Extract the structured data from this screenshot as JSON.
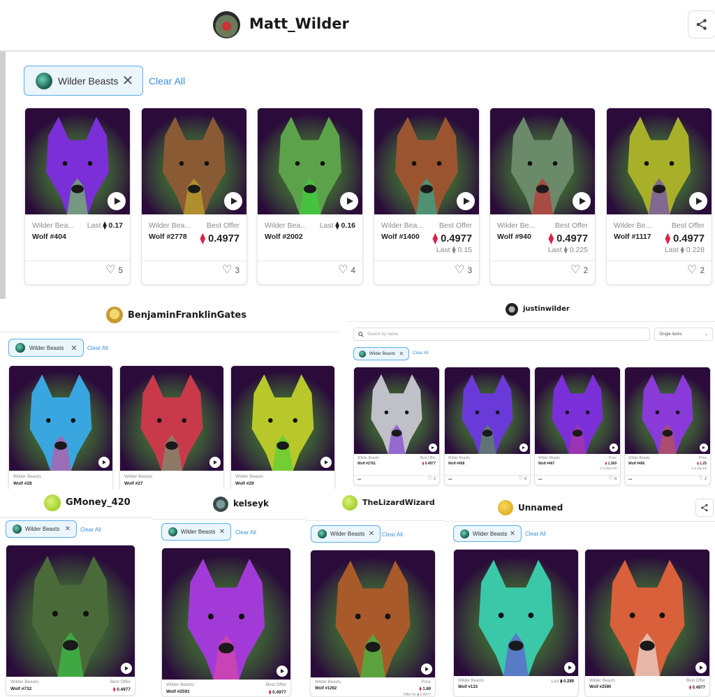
{
  "collection_label": "Wilder Beasts",
  "clear_all": "Clear All",
  "screens": {
    "matt": {
      "username": "Matt_Wilder",
      "cards": [
        {
          "collection": "Wilder Bea...",
          "name": "Wolf #404",
          "price_label": "Last",
          "price": "0.17",
          "likes": "5",
          "colors": [
            "#7a2fd8",
            "#6fe04a",
            "#2a0b3a"
          ]
        },
        {
          "collection": "Wilder Bea...",
          "name": "Wolf #2778",
          "price_label": "Best Offer",
          "price": "0.4977",
          "likes": "3",
          "colors": [
            "#8a5a34",
            "#c8b22a",
            "#2a1a0a"
          ]
        },
        {
          "collection": "Wilder Bea...",
          "name": "Wolf #2002",
          "price_label": "Last",
          "price": "0.16",
          "likes": "4",
          "colors": [
            "#5ca24a",
            "#39d63a",
            "#0d2a0b"
          ]
        },
        {
          "collection": "Wilder Bea...",
          "name": "Wolf #1400",
          "price_label": "Best Offer",
          "price": "0.4977",
          "sub_label": "Last",
          "sub_price": "0.15",
          "likes": "3",
          "colors": [
            "#9a5530",
            "#1fb8a0",
            "#2a1008"
          ]
        },
        {
          "collection": "Wilder Be...",
          "name": "Wolf #940",
          "price_label": "Best Offer",
          "price": "0.4977",
          "sub_label": "Last",
          "sub_price": "0.225",
          "likes": "2",
          "colors": [
            "#6a8a6a",
            "#d2232a",
            "#1a0a0a"
          ]
        },
        {
          "collection": "Wilder Be...",
          "name": "Wolf #1117",
          "price_label": "Best Offer",
          "price": "0.4977",
          "sub_label": "Last",
          "sub_price": "0.228",
          "likes": "2",
          "colors": [
            "#a8b02a",
            "#6a3ad8",
            "#1a1a06"
          ]
        }
      ]
    },
    "benjamin": {
      "username": "BenjaminFranklinGates",
      "cards": [
        {
          "collection": "Wilder Beasts",
          "name": "Wolf #28",
          "colors": [
            "#3aa6e0",
            "#d84a9a",
            "#05121a"
          ]
        },
        {
          "collection": "Wilder Beasts",
          "name": "Wolf #27",
          "colors": [
            "#c83a4a",
            "#6aa27a",
            "#1a0506"
          ]
        },
        {
          "collection": "Wilder Beasts",
          "name": "Wolf #29",
          "colors": [
            "#b8c82a",
            "#46d23a",
            "#0a1a05"
          ]
        }
      ]
    },
    "justin": {
      "username": "justinwilder",
      "search_placeholder": "Search by name",
      "select_value": "Single items",
      "cards": [
        {
          "collection": "Wilder Beasts",
          "name": "Wolf #2761",
          "price_label": "Best Offer",
          "price": "0.4977",
          "likes": "2",
          "colors": [
            "#c0c0c8",
            "#7a2fd8",
            "#101010"
          ]
        },
        {
          "collection": "Wilder Beasts",
          "name": "Wolf #458",
          "likes": "0",
          "colors": [
            "#6a3ad8",
            "#5a9a3a",
            "#0d061a"
          ]
        },
        {
          "collection": "Wilder Beasts",
          "name": "Wolf #467",
          "price_label": "Price",
          "price": "1.369",
          "sub_text": "5 days left",
          "likes": "0",
          "colors": [
            "#7a2fd8",
            "#b03a9a",
            "#140624"
          ]
        },
        {
          "collection": "Wilder Beasts",
          "name": "Wolf #466",
          "price_label": "Price",
          "price": "1.25",
          "sub_text": "a day left",
          "likes": "2",
          "colors": [
            "#8a3ad8",
            "#c05a2a",
            "#12061a"
          ]
        }
      ]
    },
    "gmoney": {
      "username": "GMoney_420",
      "card": {
        "collection": "Wilder Beasts",
        "name": "Wolf #732",
        "price_label": "Best Offer",
        "price": "0.4977",
        "colors": [
          "#4a6a3a",
          "#3ad24a",
          "#0a1406"
        ]
      }
    },
    "kelseyk": {
      "username": "kelseyk",
      "card": {
        "collection": "Wilder Beasts",
        "name": "Wolf #2591",
        "price_label": "Best Offer",
        "price": "0.4977",
        "colors": [
          "#a23ad8",
          "#e04aa0",
          "#14061a"
        ]
      }
    },
    "lizard": {
      "username": "TheLizardWizard",
      "card": {
        "collection": "Wilder Beasts",
        "name": "Wolf #1262",
        "price_label": "Price",
        "price": "1.69",
        "offer_label": "Offer for",
        "offer_price": "0.4977",
        "colors": [
          "#a85a2a",
          "#2ad24a",
          "#1a0a04"
        ]
      }
    },
    "unnamed": {
      "username": "Unnamed",
      "cards": [
        {
          "collection": "Wilder Beasts",
          "name": "Wolf #133",
          "price_label": "Last",
          "price": "0.289",
          "colors": [
            "#3ac8a8",
            "#6a4ad8",
            "#04140f"
          ]
        },
        {
          "collection": "Wilder Beasts",
          "name": "Wolf #2590",
          "price_label": "Best Offer",
          "price": "0.4977",
          "colors": [
            "#d8603a",
            "#f0f0f0",
            "#1a0806"
          ]
        }
      ]
    }
  }
}
